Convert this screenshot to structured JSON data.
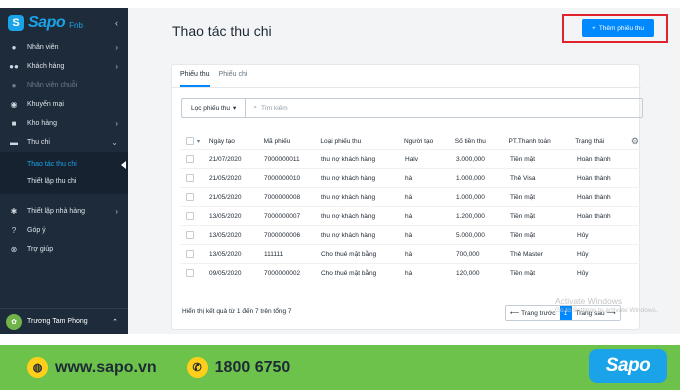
{
  "sidebar": {
    "logo_text": "Sapo",
    "logo_sub": "Fnb",
    "items": [
      {
        "label": "Nhân viên",
        "icon": "user-icon"
      },
      {
        "label": "Khách hàng",
        "icon": "users-icon"
      },
      {
        "label": "Nhân viên chuỗi",
        "icon": "user-icon"
      },
      {
        "label": "Khuyến mại",
        "icon": "discount-icon"
      },
      {
        "label": "Kho hàng",
        "icon": "box-icon"
      },
      {
        "label": "Thu chi",
        "icon": "wallet-icon"
      }
    ],
    "submenu": [
      {
        "label": "Thao tác thu chi"
      },
      {
        "label": "Thiết lập thu chi"
      }
    ],
    "items2": [
      {
        "label": "Thiết lập nhà hàng",
        "icon": "gear-icon"
      },
      {
        "label": "Góp ý",
        "icon": "question-icon"
      },
      {
        "label": "Trợ giúp",
        "icon": "help-icon"
      }
    ],
    "user_name": "Trương Tam Phong"
  },
  "header": {
    "title": "Thao tác thu chi",
    "add_button": "Thêm phiếu thu",
    "add_button_icon": "+"
  },
  "tabs": [
    "Phiếu thu",
    "Phiếu chi"
  ],
  "filter": {
    "label": "Lọc phiếu thu",
    "search_placeholder": "Tìm kiếm"
  },
  "table": {
    "columns": [
      "Ngày tạo",
      "Mã phiếu",
      "Loại phiếu thu",
      "Người tạo",
      "Số tiền thu",
      "PT.Thanh toán",
      "Trạng thái"
    ],
    "rows": [
      {
        "date": "21/07/2020",
        "code": "7000000011",
        "type": "thu nợ khách hàng",
        "user": "Halv",
        "amount": "3.000,000",
        "pay": "Tiền mặt",
        "status": "Hoàn thành"
      },
      {
        "date": "21/05/2020",
        "code": "7000000010",
        "type": "thu nợ khách hàng",
        "user": "hà",
        "amount": "1.000,000",
        "pay": "Thẻ Visa",
        "status": "Hoàn thành"
      },
      {
        "date": "21/05/2020",
        "code": "7000000008",
        "type": "thu nợ khách hàng",
        "user": "hà",
        "amount": "1.000,000",
        "pay": "Tiền mặt",
        "status": "Hoàn thành"
      },
      {
        "date": "13/05/2020",
        "code": "7000000007",
        "type": "thu nợ khách hàng",
        "user": "hà",
        "amount": "1.200,000",
        "pay": "Tiền mặt",
        "status": "Hoàn thành"
      },
      {
        "date": "13/05/2020",
        "code": "7000000006",
        "type": "thu nợ khách hàng",
        "user": "hà",
        "amount": "5.000,000",
        "pay": "Tiền mặt",
        "status": "Hủy"
      },
      {
        "date": "13/05/2020",
        "code": "111111",
        "type": "Cho thuê mặt bằng",
        "user": "hà",
        "amount": "700,000",
        "pay": "Thẻ Master",
        "status": "Hủy"
      },
      {
        "date": "09/05/2020",
        "code": "7000000002",
        "type": "Cho thuê mặt bằng",
        "user": "hà",
        "amount": "120,000",
        "pay": "Tiền mặt",
        "status": "Hủy"
      }
    ]
  },
  "footer": {
    "summary": "Hiển thị kết quả từ 1 đến 7 trên tổng 7",
    "prev": "Trang trước",
    "page": "1",
    "next": "Trang sau"
  },
  "watermark": {
    "line1": "Activate Windows",
    "line2": "Go to Settings to activate Windows."
  },
  "banner": {
    "website": "www.sapo.vn",
    "phone": "1800 6750",
    "brand": "Sapo"
  },
  "colors": {
    "accent": "#0088ff",
    "sidebar": "#1d2b3a",
    "highlight": "#e1232b",
    "banner": "#6cc24a"
  }
}
